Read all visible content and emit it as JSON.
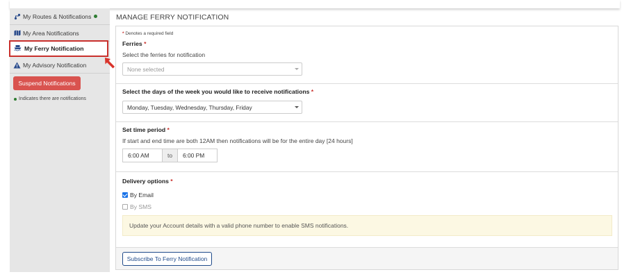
{
  "sidebar": {
    "items": [
      {
        "label": "My Routes & Notifications",
        "icon": "routes-icon"
      },
      {
        "label": "My Area Notifications",
        "icon": "map-icon"
      },
      {
        "label": "My Ferry Notification",
        "icon": "ferry-icon"
      },
      {
        "label": "My Advisory Notification",
        "icon": "warning-icon"
      }
    ],
    "suspend_label": "Suspend Notifications",
    "legend_text": "Indicates there are notifications"
  },
  "colors": {
    "notify_dot": "#2e7d32",
    "required": "#c9302c",
    "suspend_button": "#d9534f",
    "active_border": "#c9302c",
    "primary": "#1f4a8a"
  },
  "page_title": "MANAGE FERRY NOTIFICATION",
  "form": {
    "required_note": "Denotes a required field",
    "ferries": {
      "label": "Ferries",
      "help": "Select the ferries for notification",
      "value": "None selected"
    },
    "days": {
      "label": "Select the days of the week you would like to receive notifications",
      "value": "Monday, Tuesday, Wednesday, Thursday, Friday"
    },
    "time": {
      "label": "Set time period",
      "help": "If start and end time are both 12AM then notifications will be for the entire day [24 hours]",
      "start": "6:00 AM",
      "to": "to",
      "end": "6:00 PM"
    },
    "delivery": {
      "label": "Delivery options",
      "email_label": "By Email",
      "email_checked": true,
      "sms_label": "By SMS",
      "sms_checked": false,
      "alert": "Update your Account details with a valid phone number to enable SMS notifications."
    },
    "subscribe_label": "Subscribe To Ferry Notification"
  }
}
